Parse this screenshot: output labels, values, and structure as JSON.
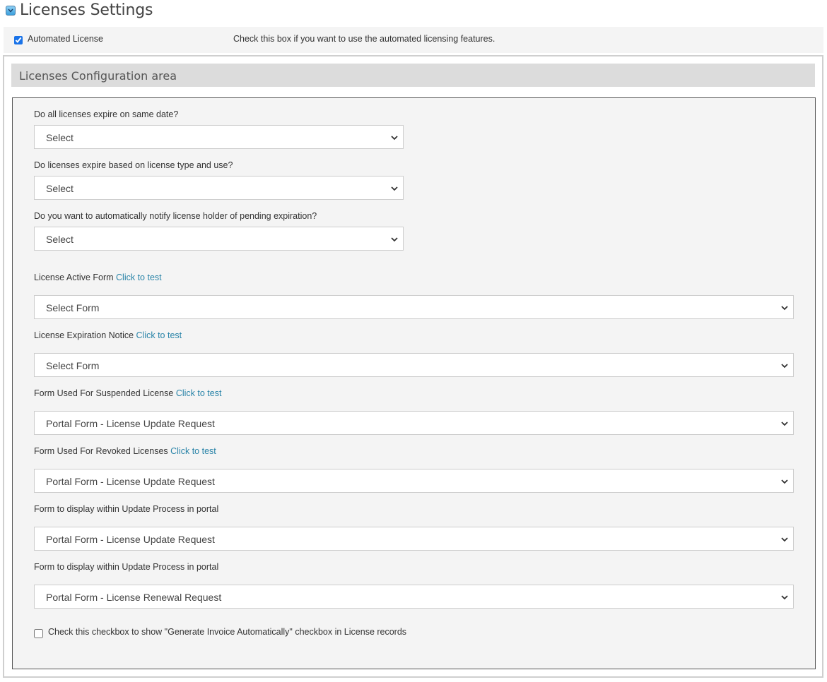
{
  "header": {
    "title": "Licenses Settings",
    "icon": "collapse-toggle-icon"
  },
  "automated": {
    "checked": true,
    "label": "Automated License",
    "description": "Check this box if you want to use the automated licensing features."
  },
  "config": {
    "title": "Licenses Configuration area",
    "questions": [
      {
        "label": "Do all licenses expire on same date?",
        "value": "Select"
      },
      {
        "label": "Do licenses expire based on license type and use?",
        "value": "Select"
      },
      {
        "label": "Do you want to automatically notify license holder of pending expiration?",
        "value": "Select"
      }
    ],
    "forms": [
      {
        "label": "License Active Form",
        "link": "Click to test",
        "value": "Select Form"
      },
      {
        "label": "License Expiration Notice",
        "link": "Click to test",
        "value": "Select Form"
      },
      {
        "label": "Form Used For Suspended License",
        "link": "Click to test",
        "value": "Portal Form - License Update Request"
      },
      {
        "label": "Form Used For Revoked Licenses",
        "link": "Click to test",
        "value": "Portal Form - License Update Request"
      },
      {
        "label": "Form to display within Update Process in portal",
        "value": "Portal Form - License Update Request"
      },
      {
        "label": "Form to display within Update Process in portal",
        "value": "Portal Form - License Renewal Request"
      }
    ],
    "invoice_checkbox": {
      "checked": false,
      "label": "Check this checkbox to show \"Generate Invoice Automatically\" checkbox in License records"
    }
  },
  "colors": {
    "link": "#2a84a8",
    "panel_bg": "#f4f4f4",
    "header_bg": "#dcdcdc"
  }
}
